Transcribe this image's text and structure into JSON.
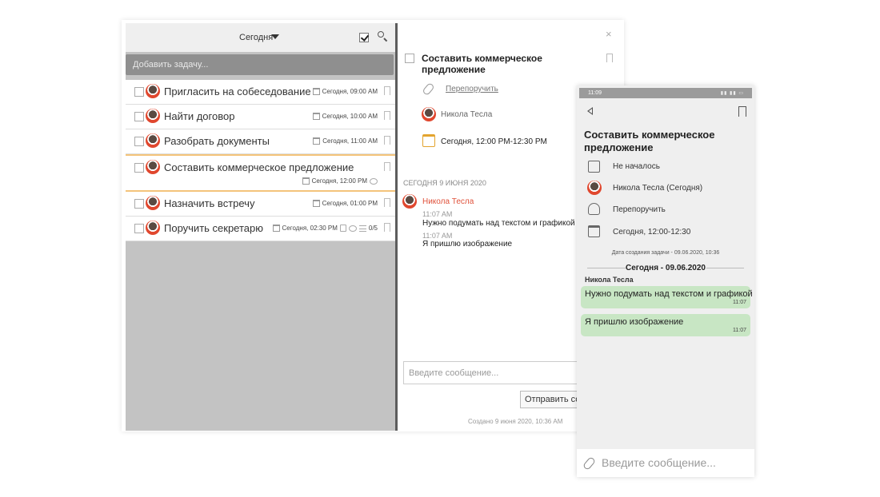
{
  "desktop": {
    "toolbar": {
      "filter_label": "Сегодня"
    },
    "add_task_placeholder": "Добавить задачу...",
    "tasks": [
      {
        "title": "Пригласить на собеседование",
        "meta": "Сегодня, 09:00 AM"
      },
      {
        "title": "Найти договор",
        "meta": "Сегодня, 10:00 AM"
      },
      {
        "title": "Разобрать документы",
        "meta": "Сегодня, 11:00 AM"
      },
      {
        "title": "Составить коммерческое предложение",
        "meta": "Сегодня, 12:00 PM"
      },
      {
        "title": "Назначить встречу",
        "meta": "Сегодня, 01:00 PM"
      },
      {
        "title": "Поручить секретарю",
        "meta": "Сегодня, 02:30 PM",
        "subtasks": "0/5"
      }
    ],
    "detail": {
      "close": "×",
      "title": "Составить коммерческое предложение",
      "reassign": "Перепоручить",
      "assignee": "Никола Тесла",
      "time": "Сегодня, 12:00 PM-12:30 PM",
      "date_header": "СЕГОДНЯ 9 ИЮНЯ 2020",
      "comment_author": "Никола Тесла",
      "messages": [
        {
          "time": "11:07 AM",
          "text": "Нужно подумать над текстом и графикой"
        },
        {
          "time": "11:07 AM",
          "text": "Я пришлю изображение"
        }
      ],
      "message_placeholder": "Введите сообщение...",
      "send_label": "Отправить со",
      "created": "Создано 9 июня 2020, 10:36 AM"
    }
  },
  "mobile": {
    "status_time": "11:09",
    "title": "Составить коммерческое предложение",
    "status": "Не началось",
    "assignee": "Никола Тесла (Сегодня)",
    "reassign": "Перепоручить",
    "time": "Сегодня, 12:00-12:30",
    "created": "Дата создания задачи - 09.06.2020, 10:36",
    "day": "Сегодня - 09.06.2020",
    "author": "Никола Тесла",
    "messages": [
      {
        "text": "Нужно подумать над текстом и графикой",
        "time": "11:07"
      },
      {
        "text": "Я пришлю изображение",
        "time": "11:07"
      }
    ],
    "input_placeholder": "Введите сообщение..."
  }
}
